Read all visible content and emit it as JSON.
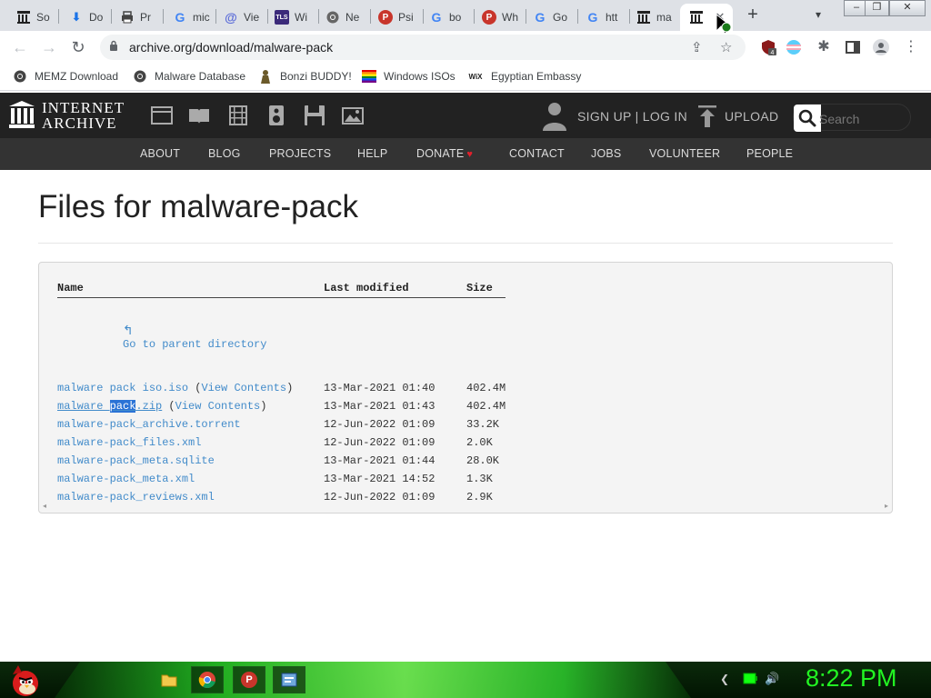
{
  "browser": {
    "tabs": [
      {
        "label": "So",
        "icon": "archive-icon"
      },
      {
        "label": "Do",
        "icon": "download-icon"
      },
      {
        "label": "Pr",
        "icon": "print-icon"
      },
      {
        "label": "mic",
        "icon": "google-icon"
      },
      {
        "label": "Vie",
        "icon": "at-icon"
      },
      {
        "label": "Wi",
        "icon": "tls-icon"
      },
      {
        "label": "Ne",
        "icon": "chrome-icon"
      },
      {
        "label": "Psi",
        "icon": "p-icon"
      },
      {
        "label": "bo",
        "icon": "google-icon"
      },
      {
        "label": "Wh",
        "icon": "p-icon"
      },
      {
        "label": "Go",
        "icon": "google-icon"
      },
      {
        "label": "htt",
        "icon": "google-icon"
      },
      {
        "label": "ma",
        "icon": "archive-icon"
      },
      {
        "label": "",
        "icon": "archive-icon",
        "active": true
      }
    ],
    "new_tab": "+",
    "url": "archive.org/download/malware-pack",
    "bookmarks": [
      {
        "label": "MEMZ Download",
        "icon": "globe-icon"
      },
      {
        "label": "Malware Database",
        "icon": "globe-icon"
      },
      {
        "label": "Bonzi BUDDY!",
        "icon": "bonzi-icon"
      },
      {
        "label": "Windows ISOs",
        "icon": "windows-flag-icon"
      },
      {
        "label": "Egyptian Embassy",
        "icon": "wix-icon"
      }
    ],
    "extension_badge": "4"
  },
  "ia": {
    "logo_line1": "INTERNET",
    "logo_line2": "ARCHIVE",
    "signup": "SIGN UP | LOG IN",
    "upload": "UPLOAD",
    "search_placeholder": "Search",
    "nav": [
      "ABOUT",
      "BLOG",
      "PROJECTS",
      "HELP",
      "DONATE",
      "CONTACT",
      "JOBS",
      "VOLUNTEER",
      "PEOPLE"
    ]
  },
  "page": {
    "title": "Files for malware-pack",
    "columns": {
      "name": "Name",
      "modified": "Last modified",
      "size": "Size"
    },
    "parent_link": "Go to parent directory",
    "files": [
      {
        "name": "malware pack iso.iso",
        "view": "View Contents",
        "modified": "13-Mar-2021 01:40",
        "size": "402.4M"
      },
      {
        "name_a": "malware ",
        "name_sel": "pack",
        "name_b": ".zip",
        "view": "View Contents",
        "modified": "13-Mar-2021 01:43",
        "size": "402.4M"
      },
      {
        "name": "malware-pack_archive.torrent",
        "modified": "12-Jun-2022 01:09",
        "size": "33.2K"
      },
      {
        "name": "malware-pack_files.xml",
        "modified": "12-Jun-2022 01:09",
        "size": "2.0K"
      },
      {
        "name": "malware-pack_meta.sqlite",
        "modified": "13-Mar-2021 01:44",
        "size": "28.0K"
      },
      {
        "name": "malware-pack_meta.xml",
        "modified": "13-Mar-2021 14:52",
        "size": "1.3K"
      },
      {
        "name": "malware-pack_reviews.xml",
        "modified": "12-Jun-2022 01:09",
        "size": "2.9K"
      }
    ]
  },
  "taskbar": {
    "clock": "8:22 PM"
  }
}
